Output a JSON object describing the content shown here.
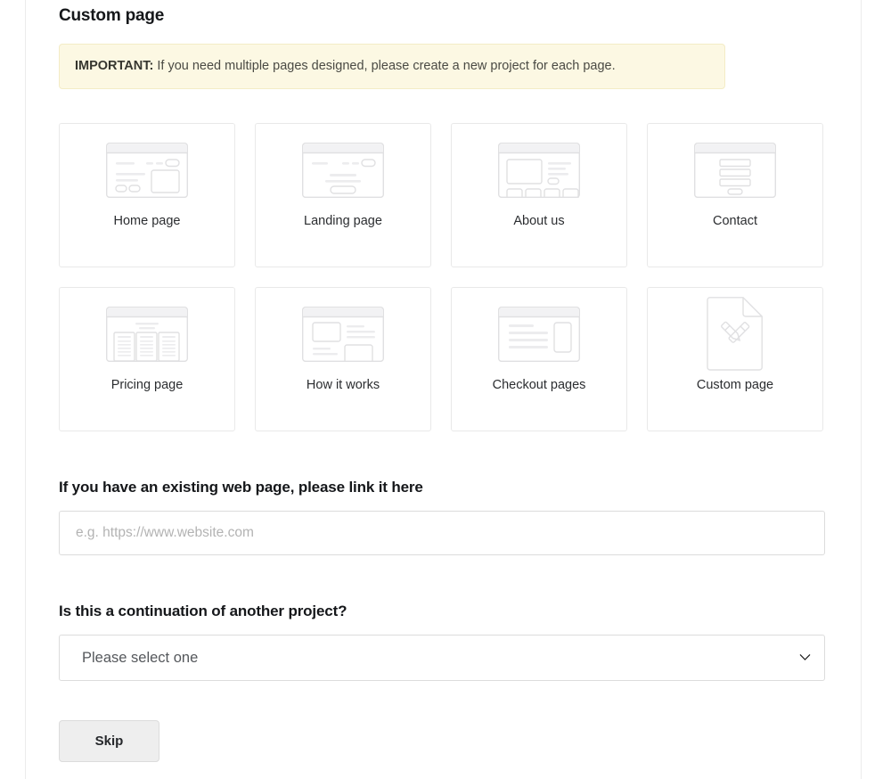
{
  "section": {
    "title": "Custom page"
  },
  "notice": {
    "strong": "IMPORTANT:",
    "text": " If you need multiple pages designed, please create a new project for each page."
  },
  "page_types": [
    {
      "label": "Home page",
      "icon": "home-page-wireframe-icon"
    },
    {
      "label": "Landing page",
      "icon": "landing-page-wireframe-icon"
    },
    {
      "label": "About us",
      "icon": "about-us-wireframe-icon"
    },
    {
      "label": "Contact",
      "icon": "contact-form-wireframe-icon"
    },
    {
      "label": "Pricing page",
      "icon": "pricing-table-wireframe-icon"
    },
    {
      "label": "How it works",
      "icon": "how-it-works-wireframe-icon"
    },
    {
      "label": "Checkout pages",
      "icon": "checkout-wireframe-icon"
    },
    {
      "label": "Custom page",
      "icon": "custom-page-document-tools-icon"
    }
  ],
  "existing_page": {
    "label": "If you have an existing web page, please link it here",
    "placeholder": "e.g. https://www.website.com",
    "value": ""
  },
  "continuation": {
    "label": "Is this a continuation of another project?",
    "selected": "Please select one",
    "options": [
      "Please select one"
    ]
  },
  "actions": {
    "skip_label": "Skip"
  },
  "colors": {
    "notice_bg": "#fcf8e3",
    "notice_border": "#f3ecc6",
    "card_border": "#e9e9e9",
    "input_border": "#dcdcdc",
    "skip_bg": "#eeeeee",
    "text_primary": "#15171a",
    "placeholder": "#b3b3b3"
  }
}
